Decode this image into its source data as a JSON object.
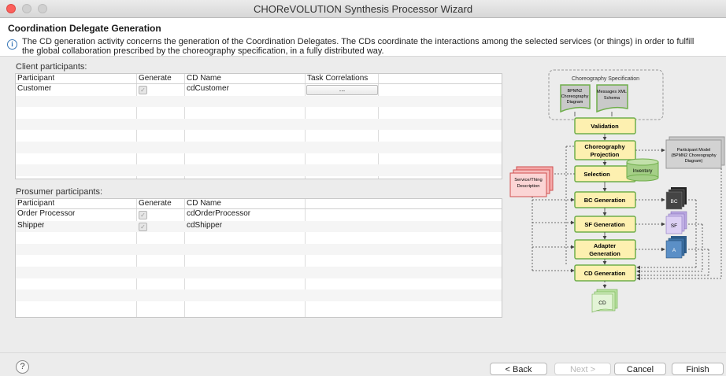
{
  "window": {
    "title": "CHOReVOLUTION Synthesis Processor Wizard"
  },
  "header": {
    "title": "Coordination Delegate Generation",
    "description": "The CD generation activity concerns the generation of the Coordination Delegates. The CDs coordinate the interactions among the selected services (or things) in order to fulfill the global collaboration prescribed by the choreography specification, in a fully distributed way."
  },
  "client": {
    "label": "Client participants:",
    "columns": [
      "Participant",
      "Generate",
      "CD Name",
      "Task Correlations"
    ],
    "rows": [
      {
        "participant": "Customer",
        "generate": true,
        "cd_name": "cdCustomer",
        "task_btn": "..."
      }
    ]
  },
  "prosumer": {
    "label": "Prosumer participants:",
    "columns": [
      "Participant",
      "Generate",
      "CD Name"
    ],
    "rows": [
      {
        "participant": "Order Processor",
        "generate": true,
        "cd_name": "cdOrderProcessor"
      },
      {
        "participant": "Shipper",
        "generate": true,
        "cd_name": "cdShipper"
      }
    ]
  },
  "diagram": {
    "spec_title": "Choreography Specification",
    "bpmn": [
      "BPMN2",
      "Choreography",
      "Diagram"
    ],
    "xml": [
      "Messages XML",
      "Schema"
    ],
    "validation": "Validation",
    "projection": [
      "Choreography",
      "Projection"
    ],
    "participant_model": [
      "Participant Model",
      "(BPMN2 Choreography",
      "Diagram)"
    ],
    "selection": "Selection",
    "inventory": "Inventory",
    "service_desc": [
      "Service/Thing",
      "Description"
    ],
    "bc_gen": "BC Generation",
    "bc": "BC",
    "sf_gen": "SF Generation",
    "sf": "SF",
    "adapter_gen": [
      "Adapter",
      "Generation"
    ],
    "a": "A",
    "cd_gen": "CD Generation",
    "cd": "CD"
  },
  "footer": {
    "help": "?",
    "back": "< Back",
    "next": "Next >",
    "cancel": "Cancel",
    "finish": "Finish"
  },
  "colors": {
    "process_fill": "#fdf0b0",
    "process_border": "#6fae4b",
    "close": "#fc605c"
  }
}
